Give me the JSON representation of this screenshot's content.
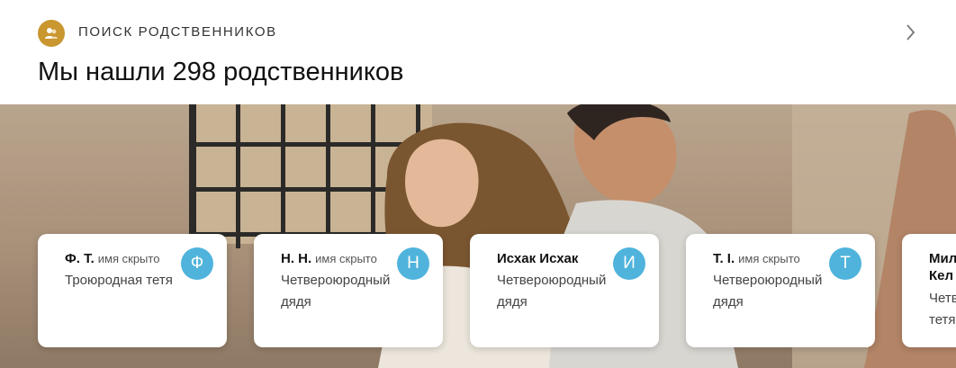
{
  "header": {
    "section_label": "ПОИСК РОДСТВЕННИКОВ",
    "headline": "Мы нашли 298 родственников"
  },
  "icons": {
    "section": "people-icon",
    "next": "chevron-right-icon"
  },
  "colors": {
    "accent_gold": "#c9962f",
    "avatar_blue": "#4fb3dc"
  },
  "relatives": [
    {
      "name": "Ф. Т.",
      "hidden_label": "имя скрыто",
      "relation": "Троюродная тетя",
      "initial": "Ф"
    },
    {
      "name": "Н. Н.",
      "hidden_label": "имя скрыто",
      "relation": "Четвероюродный дядя",
      "initial": "Н"
    },
    {
      "name": "Исхак Исхак",
      "hidden_label": "",
      "relation": "Четвероюродный дядя",
      "initial": "И"
    },
    {
      "name": "Т. І.",
      "hidden_label": "имя скрыто",
      "relation": "Четвероюродный дядя",
      "initial": "Т"
    },
    {
      "name": "Мил Кел",
      "hidden_label": "",
      "relation": "Четв тетя",
      "initial": ""
    }
  ]
}
